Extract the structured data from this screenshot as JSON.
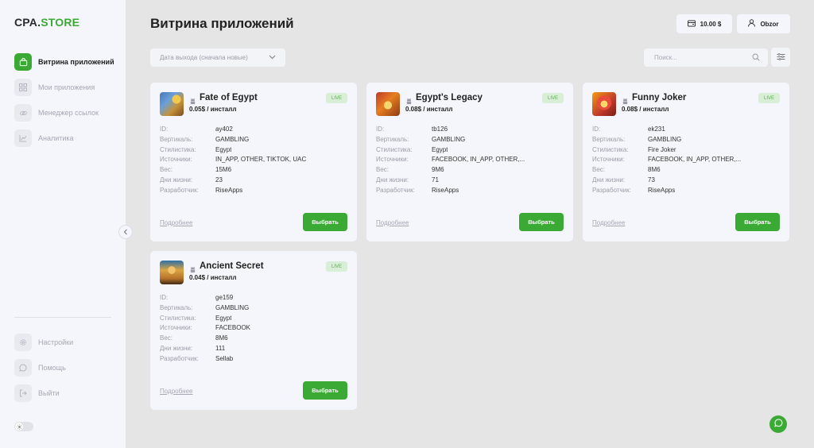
{
  "logo": {
    "part1": "CPA.",
    "part2": "STORE"
  },
  "sidebar": {
    "items": [
      {
        "label": "Витрина приложений",
        "icon": "bag-icon",
        "active": true
      },
      {
        "label": "Мои приложения",
        "icon": "grid-icon"
      },
      {
        "label": "Менеджер ссылок",
        "icon": "link-icon"
      },
      {
        "label": "Аналитика",
        "icon": "chart-icon"
      }
    ],
    "bottom_items": [
      {
        "label": "Настройки",
        "icon": "gear-icon"
      },
      {
        "label": "Помощь",
        "icon": "chat-bubble-icon"
      },
      {
        "label": "Выйти",
        "icon": "logout-icon"
      }
    ]
  },
  "header": {
    "title": "Витрина приложений",
    "balance": "10.00 $",
    "user": "Obzor"
  },
  "filters": {
    "sort_value": "Дата выхода (сначала новые)",
    "search_placeholder": "Поиск..."
  },
  "labels": {
    "id": "ID:",
    "vertical": "Вертикаль:",
    "style": "Стилистика:",
    "sources": "Источники:",
    "weight": "Вес:",
    "lifetime": "Дни жизни:",
    "developer": "Разработчик:",
    "more": "Подробнее",
    "select": "Выбрать",
    "live": "LIVE"
  },
  "apps": [
    {
      "name": "Fate of Egypt",
      "price": "0.05$ / инсталл",
      "id": "ay402",
      "vertical": "GAMBLING",
      "style": "Egypt",
      "sources": "IN_APP, OTHER, TIKTOK, UAC",
      "weight": "15M6",
      "lifetime": "23",
      "developer": "RiseApps"
    },
    {
      "name": "Egypt's Legacy",
      "price": "0.08$ / инсталл",
      "id": "tb126",
      "vertical": "GAMBLING",
      "style": "Egypt",
      "sources": "FACEBOOK, IN_APP, OTHER,...",
      "weight": "9M6",
      "lifetime": "71",
      "developer": "RiseApps"
    },
    {
      "name": "Funny Joker",
      "price": "0.08$ / инсталл",
      "id": "ek231",
      "vertical": "GAMBLING",
      "style": "Fire Joker",
      "sources": "FACEBOOK, IN_APP, OTHER,...",
      "weight": "8M6",
      "lifetime": "73",
      "developer": "RiseApps"
    },
    {
      "name": "Ancient Secret",
      "price": "0.04$ / инсталл",
      "id": "ge159",
      "vertical": "GAMBLING",
      "style": "Egypt",
      "sources": "FACEBOOK",
      "weight": "8M6",
      "lifetime": "111",
      "developer": "Sellab"
    }
  ],
  "colors": {
    "accent": "#3aaa35",
    "live_bg": "#d9eed6",
    "card_bg": "#f5f6fb",
    "page_bg": "#e5e5e5"
  }
}
